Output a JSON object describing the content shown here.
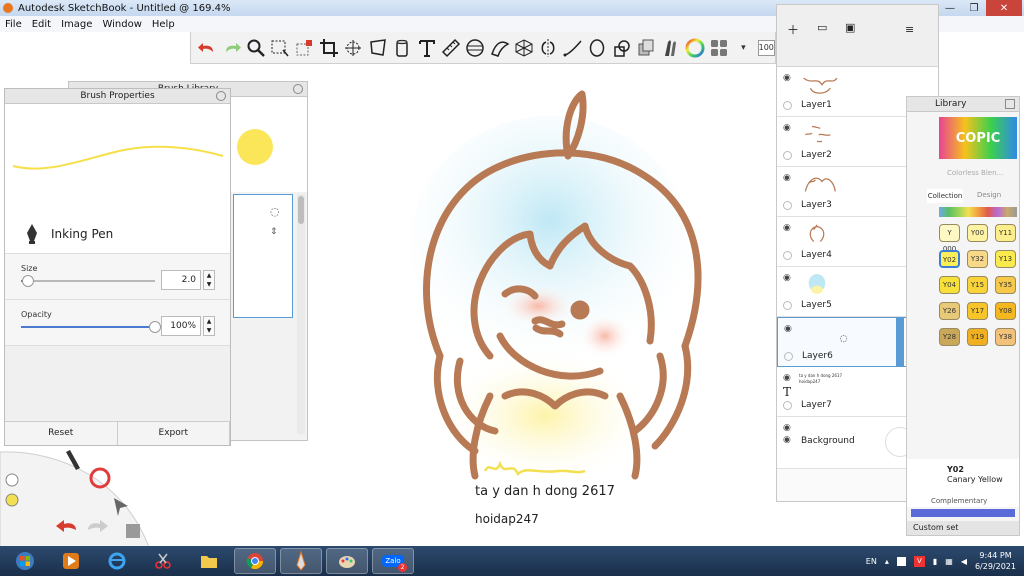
{
  "window": {
    "title": "Autodesk SketchBook - Untitled @ 169.4%",
    "controls": [
      "—",
      "❐",
      "✕"
    ]
  },
  "menu": [
    "File",
    "Edit",
    "Image",
    "Window",
    "Help"
  ],
  "toolbar": {
    "icons": [
      "undo-icon",
      "redo-icon",
      "zoom-icon",
      "select-icon",
      "select-alt-icon",
      "crop-icon",
      "transform-icon",
      "distort-icon",
      "fill-icon",
      "text-icon",
      "ruler-icon",
      "ellipse-guide-icon",
      "french-curve-icon",
      "perspective-icon",
      "symmetry-icon",
      "stroke-icon",
      "ellipse-icon",
      "shape-icon",
      "copy-icon",
      "brush-icon",
      "color-wheel-icon",
      "grid-icon"
    ],
    "opacity_value": "100"
  },
  "brush_properties": {
    "title": "Brush Properties",
    "brush_name": "Inking Pen",
    "size_label": "Size",
    "size_value": "2.0",
    "size_level": 0.05,
    "opacity_label": "Opacity",
    "opacity_value": "100%",
    "opacity_level": 1.0,
    "reset_label": "Reset",
    "export_label": "Export"
  },
  "brush_library": {
    "title": "Brush Library"
  },
  "layers": [
    {
      "name": "Layer1"
    },
    {
      "name": "Layer2"
    },
    {
      "name": "Layer3"
    },
    {
      "name": "Layer4"
    },
    {
      "name": "Layer5"
    },
    {
      "name": "Layer6",
      "selected": true
    },
    {
      "name": "Layer7",
      "text": "ta y dan h dong 2617 hoidap247"
    },
    {
      "name": "Background"
    }
  ],
  "copic": {
    "title": "Library",
    "brand": "COPIC",
    "colorless": "Colorless Blen...",
    "tab_palette": "Collection",
    "tab_design": "Design",
    "swatches": [
      {
        "code": "Y 000",
        "color": "#fdf8c4"
      },
      {
        "code": "Y00",
        "color": "#fdf3a2"
      },
      {
        "code": "Y11",
        "color": "#fcee8a"
      },
      {
        "code": "Y02",
        "color": "#fbee58"
      },
      {
        "code": "Y32",
        "color": "#f8d98a"
      },
      {
        "code": "Y13",
        "color": "#f9ea4d"
      },
      {
        "code": "Y04",
        "color": "#f7e03a"
      },
      {
        "code": "Y15",
        "color": "#f8d43a"
      },
      {
        "code": "Y35",
        "color": "#f6c94a"
      },
      {
        "code": "Y26",
        "color": "#e8c978"
      },
      {
        "code": "Y17",
        "color": "#f5c52a"
      },
      {
        "code": "Y08",
        "color": "#f4b81e"
      },
      {
        "code": "Y28",
        "color": "#c9a85a"
      },
      {
        "code": "Y19",
        "color": "#f0b020"
      },
      {
        "code": "Y38",
        "color": "#f2c27a"
      }
    ],
    "selected_code": "Y02",
    "selected_name": "Canary Yellow",
    "complementary": "Complementary",
    "custom_set": "Custom set"
  },
  "canvas": {
    "text_line1": "ta y dan h dong 2617",
    "text_line2": "hoidap247"
  },
  "taskbar": {
    "apps": [
      "windows-start-icon",
      "media-player-icon",
      "ie-icon",
      "snipping-icon",
      "folder-icon",
      "chrome-icon",
      "sketchbook-icon",
      "paint-icon",
      "zalo-icon"
    ],
    "zalo_label": "Zalo",
    "zalo_badge": "2",
    "lang": "EN",
    "time": "9:44 PM",
    "date": "6/29/2021"
  }
}
